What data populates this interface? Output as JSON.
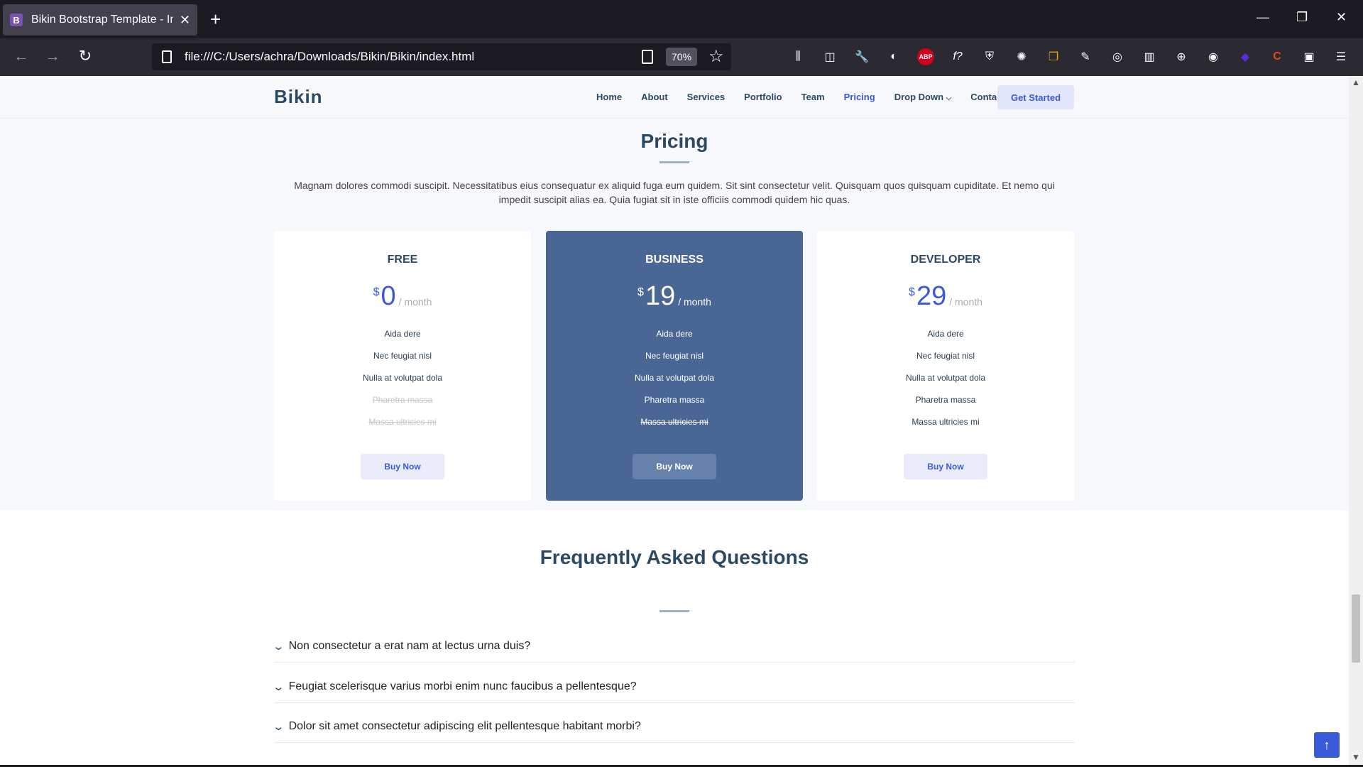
{
  "browser": {
    "tab_title": "Bikin Bootstrap Template - Index",
    "favicon_letter": "B",
    "url": "file:///C:/Users/achra/Downloads/Bikin/Bikin/index.html",
    "zoom": "70%"
  },
  "site": {
    "logo": "Bikin",
    "menu": [
      "Home",
      "About",
      "Services",
      "Portfolio",
      "Team",
      "Pricing",
      "Drop Down",
      "Contact"
    ],
    "active_menu": "Pricing",
    "cta": "Get Started"
  },
  "pricing": {
    "title": "Pricing",
    "description": "Magnam dolores commodi suscipit. Necessitatibus eius consequatur ex aliquid fuga eum quidem. Sit sint consectetur velit. Quisquam quos quisquam cupiditate. Et nemo qui impedit suscipit alias ea. Quia fugiat sit in iste officiis commodi quidem hic quas.",
    "plans": [
      {
        "name": "FREE",
        "currency": "$",
        "amount": "0",
        "period": "/ month",
        "featured": false,
        "features": [
          {
            "text": "Aida dere",
            "available": true
          },
          {
            "text": "Nec feugiat nisl",
            "available": true
          },
          {
            "text": "Nulla at volutpat dola",
            "available": true
          },
          {
            "text": "Pharetra massa",
            "available": false
          },
          {
            "text": "Massa ultricies mi",
            "available": false
          }
        ],
        "button": "Buy Now"
      },
      {
        "name": "BUSINESS",
        "currency": "$",
        "amount": "19",
        "period": "/ month",
        "featured": true,
        "features": [
          {
            "text": "Aida dere",
            "available": true
          },
          {
            "text": "Nec feugiat nisl",
            "available": true
          },
          {
            "text": "Nulla at volutpat dola",
            "available": true
          },
          {
            "text": "Pharetra massa",
            "available": true
          },
          {
            "text": "Massa ultricies mi",
            "available": false
          }
        ],
        "button": "Buy Now"
      },
      {
        "name": "DEVELOPER",
        "currency": "$",
        "amount": "29",
        "period": "/ month",
        "featured": false,
        "features": [
          {
            "text": "Aida dere",
            "available": true
          },
          {
            "text": "Nec feugiat nisl",
            "available": true
          },
          {
            "text": "Nulla at volutpat dola",
            "available": true
          },
          {
            "text": "Pharetra massa",
            "available": true
          },
          {
            "text": "Massa ultricies mi",
            "available": true
          }
        ],
        "button": "Buy Now"
      }
    ]
  },
  "faq": {
    "title": "Frequently Asked Questions",
    "questions": [
      "Non consectetur a erat nam at lectus urna duis?",
      "Feugiat scelerisque varius morbi enim nunc faucibus a pellentesque?",
      "Dolor sit amet consectetur adipiscing elit pellentesque habitant morbi?"
    ]
  },
  "colors": {
    "accent": "#3a5bd9",
    "featured": "#4a6695",
    "heading": "#2c4964"
  }
}
